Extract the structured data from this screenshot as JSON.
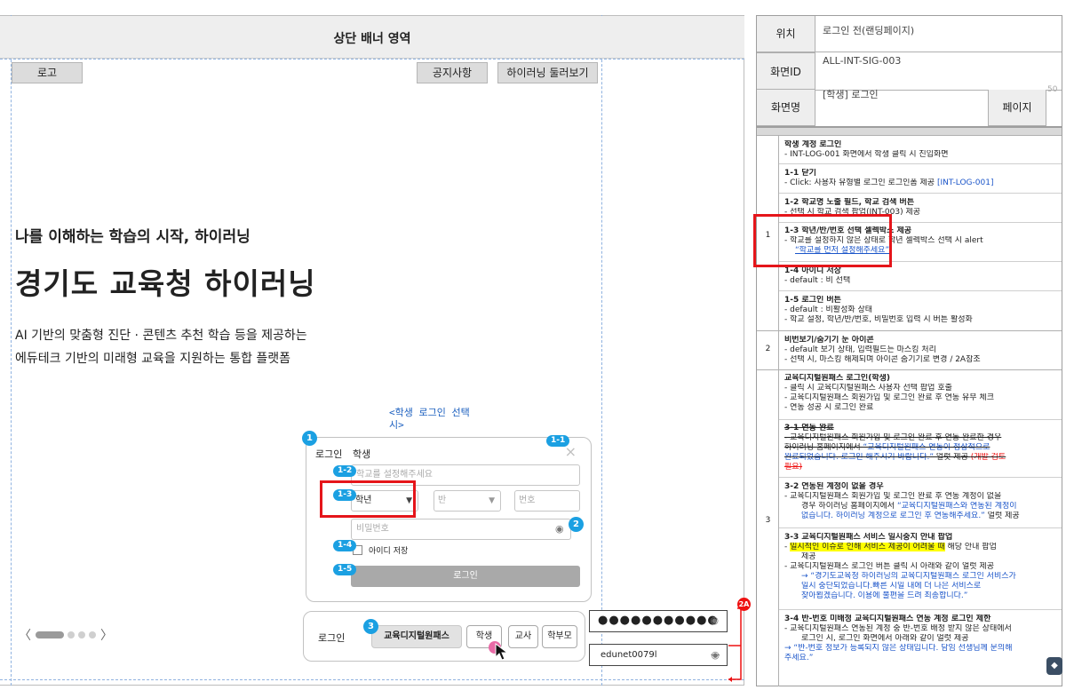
{
  "banner": {
    "title": "상단 배너 영역"
  },
  "nav": {
    "logo": "로고",
    "notice": "공지사항",
    "tour": "하이러닝 둘러보기"
  },
  "hero": {
    "subtitle": "나를 이해하는 학습의 시작, 하이러닝",
    "title": "경기도 교육청 하이러닝",
    "desc1": "AI 기반의 맞춤형 진단 · 콘텐츠 추천 학습 등을 제공하는",
    "desc2": "에듀테크 기반의 미래형 교육을 지원하는 통합 플랫폼"
  },
  "carousel": {
    "prev": "〈",
    "next": "〉"
  },
  "caption": {
    "line1": "<학생 로그인 선택",
    "line2": "시>"
  },
  "login_card": {
    "tab_login": "로그인",
    "tab_student": "학생",
    "close": "×",
    "school_placeholder": "학교를 설정해주세요",
    "grade_value": "학년",
    "class_value": "반",
    "number_value": "번호",
    "password_placeholder": "비밀번호",
    "remember_label": "아이디 저장",
    "login_button": "로그인"
  },
  "login_strip": {
    "label": "로그인",
    "edu_pass": "교육디지털원패스",
    "student": "학생",
    "teacher": "교사",
    "parent": "학부모"
  },
  "password_demo": {
    "value": "●●●●●●●●●●●"
  },
  "id_demo": {
    "value": "edunet0079l"
  },
  "badges": {
    "b1": "1",
    "b2": "2",
    "b3": "3",
    "b2a": "2A",
    "p11": "1-1",
    "p12": "1-2",
    "p13": "1-3",
    "p14": "1-4",
    "p15": "1-5"
  },
  "spec_header": {
    "location_label": "위치",
    "location_value": "로그인 전(랜딩페이지)",
    "screen_id_label": "화면ID",
    "screen_id_value": "ALL-INT-SIG-003",
    "screen_name_label": "화면명",
    "screen_name_value": "[학생] 로그인",
    "page_label": "페이지",
    "page_value": "50"
  },
  "spec": {
    "nums": [
      "1",
      "2",
      "3"
    ],
    "r1_title": "학생 계정 로그인",
    "r1_l1": "- INT-LOG-001 화면에서 학생 클릭 시 진입화면",
    "r11_title": "1-1 닫기",
    "r11_l1a": "- Click: 사용자 유형별 로그인 로그인폼 제공 ",
    "r11_l1b": "[INT-LOG-001]",
    "r12_title": "1-2 학교명 노출 필드, 학교 검색 버튼",
    "r12_l1": "- 선택 시 학교 검색 팝업(INT-003) 제공",
    "r13_title": "1-3 학년/반/번호 선택 셀렉박스 제공",
    "r13_l1": "- 학교를 설정하지 않은 상태로 학년 셀렉박스 선택 시 alert",
    "r13_l2": "“학교를 먼저 설정해주세요”",
    "r14_title": "1-4 아이디 저장",
    "r14_l1": "- default : 비 선택",
    "r15_title": "1-5 로그인 버튼",
    "r15_l1": "- default : 비활성화 상태",
    "r15_l2": "- 학교 설정, 학년/반/번호, 비밀번호 입력 시 버튼 활성화",
    "r2_title": "비번보기/숨기기 눈 아이콘",
    "r2_l1": "-     default 보기 상태, 입력필드는 마스킹 처리",
    "r2_l2": "-     선택 시, 마스킹 해제되며 아이콘 숨기기로 변경 / 2A참조",
    "r3_title": "교육디지털원패스 로그인(학생)",
    "r3_l1": "-     클릭 시 교육디지털원패스 사용자 선택 팝업 호출",
    "r3_l2": "-     교육디지털원패스 회원가입 및 로그인 완료 후 연동 유무 체크",
    "r3_l3": "-     연동 성공 시 로그인 완료",
    "r31_title": "3-1 연동 완료",
    "r31_l1": "-     교육디지털원패스 회원가입 및 로그인 완료 후 연동 완료한 경우",
    "r31_l2a": "하이러닝 홈페이지에서 ",
    "r31_l2b": "“교육디지털원패스 연동이 정상적으로",
    "r31_l3a": "완료되었습니다. 로그인 해주시기 바랍니다.”",
    "r31_l3b": " 얼럿 제공 ",
    "r31_l3c": "(개발 검토",
    "r31_l4": "필요)",
    "r32_title": "3-2 연동된 계정이 없을 경우",
    "r32_l1": "-     교육디지털원패스 회원가입 및 로그인 완료 후 연동 계정이 없을",
    "r32_l2a": "경우 하이러닝 홈페이지에서 ",
    "r32_l2b": "“교육디지털원패스와 연동된 계정이",
    "r32_l3a": "없습니다. 하이러닝 계정으로 로그인 후 연동해주세요.”",
    "r32_l3b": " 얼럿 제공",
    "r33_title": "3-3 교육디지털원패스 서비스 일시중지 안내 팝업",
    "r33_l1a": "일시적인 이슈로 인해 서비스 제공이 어려울 때",
    "r33_l1b": " 해당 안내 팝업",
    "r33_l2": "제공",
    "r33_l3": "-     교육디지털원패스 로그인 버튼 클릭 시 아래와 같이 얼럿 제공",
    "r33_l4": "→ “경기도교육청 하이러닝의 교육디지털원패스 로그인 서비스가",
    "r33_l5": "일시 중단되었습니다.빠른 시일 내에 더 나은 서비스로",
    "r33_l6": "찾아뵙겠습니다. 이용에 불편을 드려 죄송합니다.”",
    "r34_title": "3-4 반-번호 미배정 교육디지털원패스 연동 계정 로그인 제한",
    "r34_l1": "-     교육디지털원패스 연동된 계정 중 반-번호 배정 받지 않은 상태에서",
    "r34_l2": "로그인 시, 로그인 화면에서 아래와 같이 얼럿 제공",
    "r34_l3": "→ “반-번호 정보가 등록되지 않은 상태입니다. 담임 선생님께 문의해",
    "r34_l4": "주세요.”"
  },
  "colors": {
    "badge": "#1ba0e2",
    "highlight_box": "#e5151a",
    "link": "#1b55c9"
  }
}
